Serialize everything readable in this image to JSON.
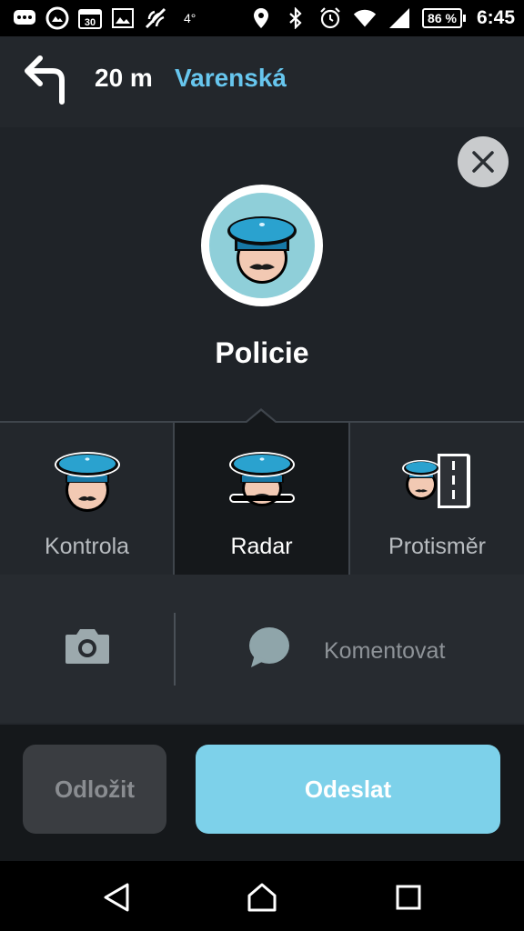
{
  "status_bar": {
    "icons_left": [
      "messaging-icon",
      "gallery-icon",
      "calendar-icon",
      "image-icon",
      "nfc-icon"
    ],
    "calendar_day": "30",
    "temperature": "4°",
    "icons_right": [
      "location-icon",
      "bluetooth-icon",
      "alarm-icon",
      "wifi-icon",
      "signal-icon"
    ],
    "battery": "86 %",
    "time": "6:45"
  },
  "navigation": {
    "turn_icon": "turn-left-icon",
    "distance": "20 m",
    "street": "Varenská"
  },
  "report": {
    "title": "Policie",
    "close_icon": "close-icon",
    "options": [
      {
        "label": "Kontrola",
        "icon": "police-officer-icon",
        "selected": false
      },
      {
        "label": "Radar",
        "icon": "police-radar-icon",
        "selected": true
      },
      {
        "label": "Protisměr",
        "icon": "police-opposite-lane-icon",
        "selected": false
      }
    ],
    "camera_icon": "camera-icon",
    "comment_icon": "comment-bubble-icon",
    "comment_label": "Komentovat"
  },
  "actions": {
    "later_label": "Odložit",
    "send_label": "Odeslat"
  },
  "system_nav": [
    "back-icon",
    "home-icon",
    "recents-icon"
  ],
  "colors": {
    "accent": "#67c6ee",
    "send_button": "#7dd1ea",
    "panel_bg": "#1f2328",
    "selected_bg": "#15181b"
  }
}
